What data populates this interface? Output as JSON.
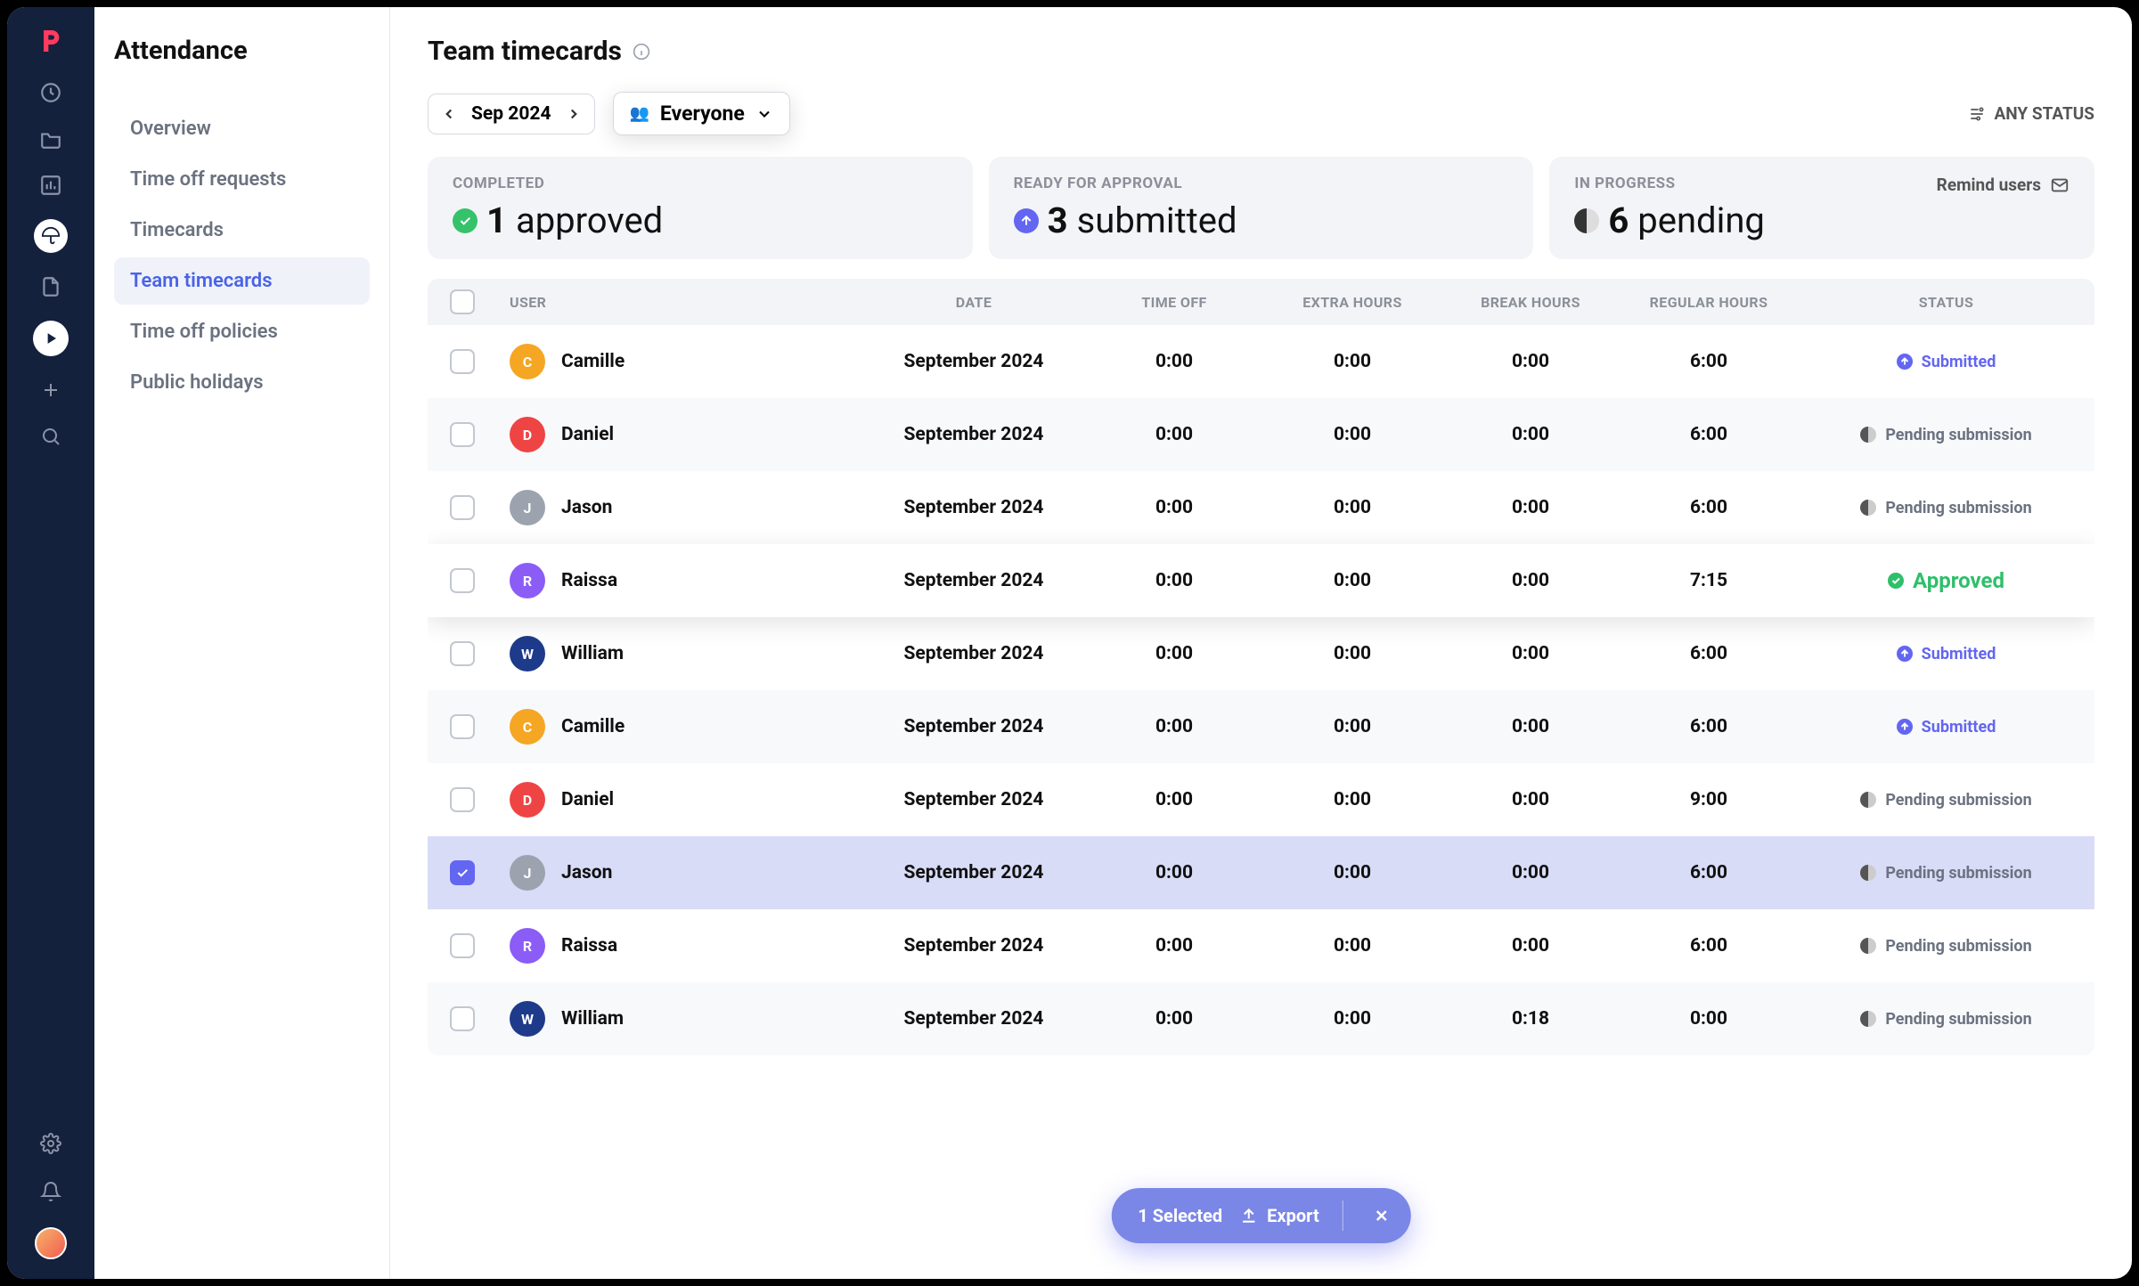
{
  "sidebar": {
    "title": "Attendance",
    "items": [
      {
        "label": "Overview",
        "active": false
      },
      {
        "label": "Time off requests",
        "active": false
      },
      {
        "label": "Timecards",
        "active": false
      },
      {
        "label": "Team timecards",
        "active": true
      },
      {
        "label": "Time off policies",
        "active": false
      },
      {
        "label": "Public holidays",
        "active": false
      }
    ]
  },
  "header": {
    "title": "Team timecards"
  },
  "toolbar": {
    "month": "Sep 2024",
    "people": "Everyone",
    "any_status": "ANY STATUS"
  },
  "summary": {
    "completed": {
      "label": "COMPLETED",
      "count": "1",
      "word": "approved"
    },
    "ready": {
      "label": "READY FOR APPROVAL",
      "count": "3",
      "word": "submitted"
    },
    "pending": {
      "label": "IN PROGRESS",
      "count": "6",
      "word": "pending",
      "action": "Remind users"
    }
  },
  "columns": {
    "user": "USER",
    "date": "DATE",
    "timeoff": "TIME OFF",
    "extra": "EXTRA HOURS",
    "break": "BREAK HOURS",
    "regular": "REGULAR HOURS",
    "status": "STATUS"
  },
  "rows": [
    {
      "name": "Camille",
      "date": "September 2024",
      "timeoff": "0:00",
      "extra": "0:00",
      "break": "0:00",
      "regular": "6:00",
      "status": "Submitted",
      "status_type": "submitted",
      "color": "#f5a623",
      "checked": false,
      "highlight": false
    },
    {
      "name": "Daniel",
      "date": "September 2024",
      "timeoff": "0:00",
      "extra": "0:00",
      "break": "0:00",
      "regular": "6:00",
      "status": "Pending submission",
      "status_type": "pending",
      "color": "#ef4444",
      "checked": false,
      "highlight": false
    },
    {
      "name": "Jason",
      "date": "September 2024",
      "timeoff": "0:00",
      "extra": "0:00",
      "break": "0:00",
      "regular": "6:00",
      "status": "Pending submission",
      "status_type": "pending",
      "color": "#9ca3af",
      "checked": false,
      "highlight": false
    },
    {
      "name": "Raissa",
      "date": "September 2024",
      "timeoff": "0:00",
      "extra": "0:00",
      "break": "0:00",
      "regular": "7:15",
      "status": "Approved",
      "status_type": "approved",
      "color": "#8b5cf6",
      "checked": false,
      "highlight": true
    },
    {
      "name": "William",
      "date": "September 2024",
      "timeoff": "0:00",
      "extra": "0:00",
      "break": "0:00",
      "regular": "6:00",
      "status": "Submitted",
      "status_type": "submitted",
      "color": "#1e3a8a",
      "checked": false,
      "highlight": false
    },
    {
      "name": "Camille",
      "date": "September 2024",
      "timeoff": "0:00",
      "extra": "0:00",
      "break": "0:00",
      "regular": "6:00",
      "status": "Submitted",
      "status_type": "submitted",
      "color": "#f5a623",
      "checked": false,
      "highlight": false
    },
    {
      "name": "Daniel",
      "date": "September 2024",
      "timeoff": "0:00",
      "extra": "0:00",
      "break": "0:00",
      "regular": "9:00",
      "status": "Pending submission",
      "status_type": "pending",
      "color": "#ef4444",
      "checked": false,
      "highlight": false
    },
    {
      "name": "Jason",
      "date": "September 2024",
      "timeoff": "0:00",
      "extra": "0:00",
      "break": "0:00",
      "regular": "6:00",
      "status": "Pending submission",
      "status_type": "pending",
      "color": "#9ca3af",
      "checked": true,
      "highlight": false
    },
    {
      "name": "Raissa",
      "date": "September 2024",
      "timeoff": "0:00",
      "extra": "0:00",
      "break": "0:00",
      "regular": "6:00",
      "status": "Pending submission",
      "status_type": "pending",
      "color": "#8b5cf6",
      "checked": false,
      "highlight": false
    },
    {
      "name": "William",
      "date": "September 2024",
      "timeoff": "0:00",
      "extra": "0:00",
      "break": "0:18",
      "regular": "0:00",
      "status": "Pending submission",
      "status_type": "pending",
      "color": "#1e3a8a",
      "checked": false,
      "highlight": false
    }
  ],
  "selection_bar": {
    "selected": "1 Selected",
    "export": "Export"
  }
}
